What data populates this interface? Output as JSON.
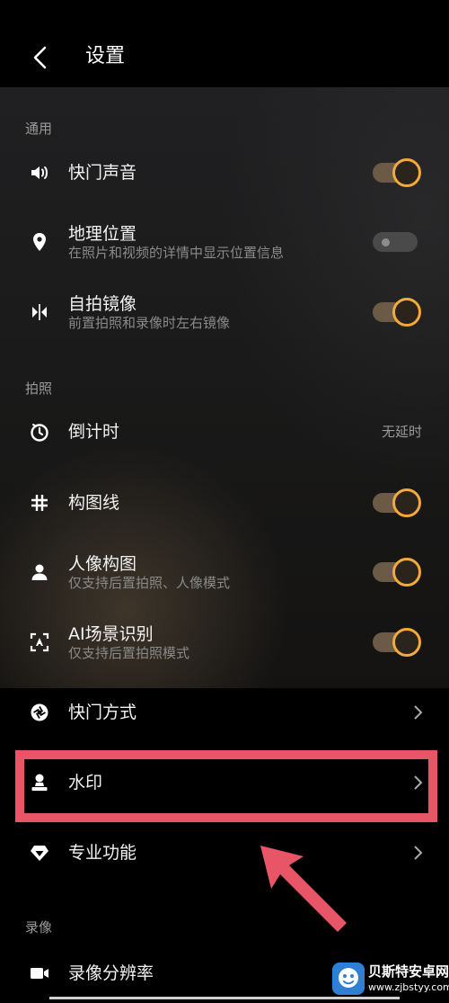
{
  "header": {
    "title": "设置"
  },
  "sections": {
    "general": "通用",
    "photo": "拍照",
    "video": "录像"
  },
  "rows": {
    "shutter_sound": {
      "title": "快门声音",
      "toggle": "on"
    },
    "location": {
      "title": "地理位置",
      "subtitle": "在照片和视频的详情中显示位置信息",
      "toggle": "off"
    },
    "selfie_mirror": {
      "title": "自拍镜像",
      "subtitle": "前置拍照和录像时左右镜像",
      "toggle": "on"
    },
    "timer": {
      "title": "倒计时",
      "value": "无延时"
    },
    "grid": {
      "title": "构图线",
      "toggle": "on"
    },
    "portrait_composition": {
      "title": "人像构图",
      "subtitle": "仅支持后置拍照、人像模式",
      "toggle": "on"
    },
    "ai_scene": {
      "title": "AI场景识别",
      "subtitle": "仅支持后置拍照模式",
      "toggle": "on"
    },
    "shutter_mode": {
      "title": "快门方式"
    },
    "watermark": {
      "title": "水印"
    },
    "pro_features": {
      "title": "专业功能"
    },
    "video_resolution": {
      "title": "录像分辨率"
    }
  },
  "site_watermark": {
    "name": "贝斯特安卓网",
    "url": "www.zjbstyy.com"
  },
  "colors": {
    "accent": "#f3a93c",
    "highlight": "#e85566",
    "background": "#000000"
  },
  "icons": {
    "back": "back-arrow-icon",
    "shutter_sound": "speaker-icon",
    "location": "location-pin-icon",
    "mirror": "mirror-icon",
    "timer": "timer-icon",
    "grid": "grid-icon",
    "portrait": "person-icon",
    "ai_scene": "ai-scene-icon",
    "shutter": "aperture-icon",
    "watermark": "stamp-icon",
    "pro": "diamond-icon",
    "video": "video-camera-icon"
  }
}
